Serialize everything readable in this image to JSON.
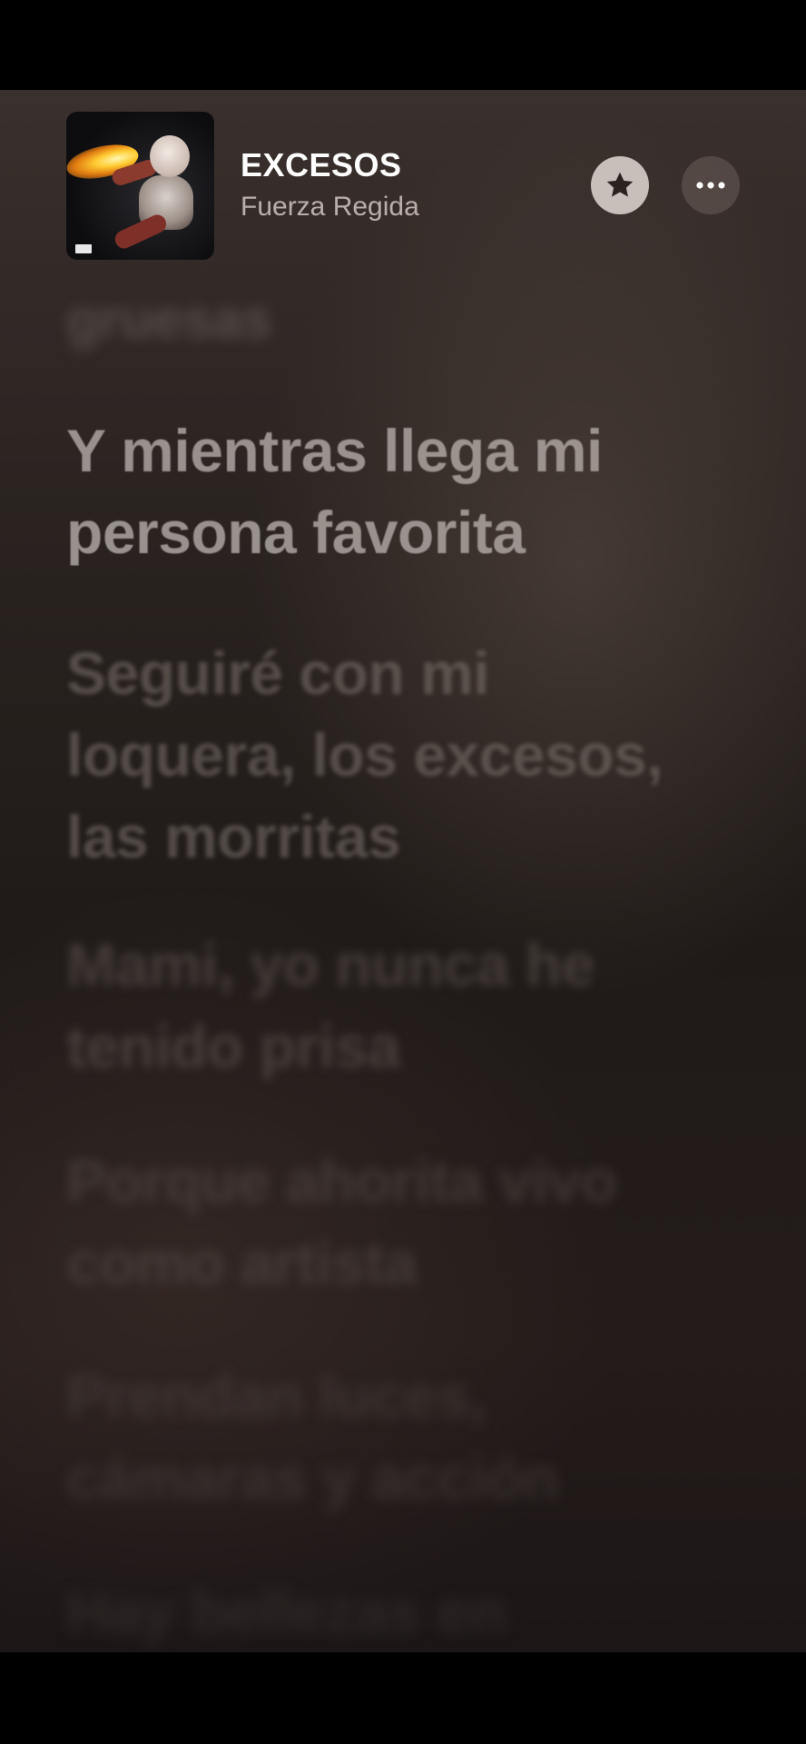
{
  "now_playing": {
    "title": "EXCESOS",
    "artist": "Fuerza Regida",
    "artwork": "album-cover-image",
    "actions": {
      "favorite_icon": "star-icon",
      "more_icon": "ellipsis-icon"
    }
  },
  "lyrics": {
    "previous": [
      "gruesas"
    ],
    "current": [
      "Y mientras llega mi",
      "persona favorita"
    ],
    "upcoming": [
      [
        "Seguiré con mi",
        "loquera, los excesos,",
        "las morritas"
      ],
      [
        "Mami, yo nunca he",
        "tenido prisa"
      ],
      [
        "Porque ahorita vivo",
        "como artista"
      ],
      [
        "Prendan luces,",
        "cámaras y acción"
      ],
      [
        "Hay bellezas en"
      ]
    ]
  }
}
